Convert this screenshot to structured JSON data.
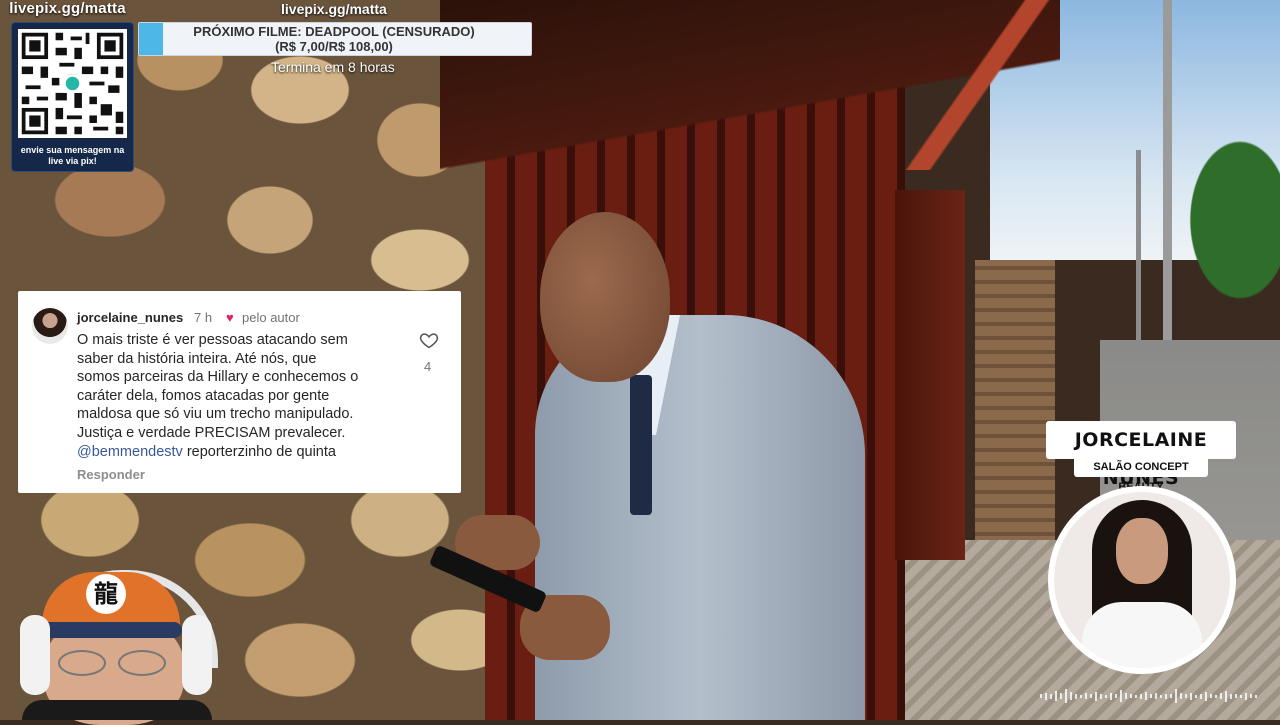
{
  "livepix": {
    "qr_title": "livepix.gg/matta",
    "qr_caption": "envie sua mensagem na live via pix!",
    "top_url": "livepix.gg/matta"
  },
  "film_banner": {
    "line1": "PRÓXIMO FILME: DEADPOOL (CENSURADO)",
    "line2": "(R$ 7,00/R$ 108,00)",
    "subtitle": "Termina em 8 horas",
    "accent_color": "#4db8e8"
  },
  "comment": {
    "username": "jorcelaine_nunes",
    "time": "7 h",
    "heart_icon": "heart-icon",
    "by_author": "pelo autor",
    "body_lines": [
      "O mais triste é ver pessoas atacando sem",
      "saber da história inteira. Até nós, que",
      "somos parceiras da Hillary e conhecemos o",
      "caráter dela, fomos atacadas por gente",
      "maldosa que só viu um trecho manipulado.",
      "Justiça e verdade PRECISAM prevalecer."
    ],
    "mention": "@bemmendestv",
    "mention_rest": " reporterzinho de quinta",
    "like_count": "4",
    "reply_label": "Responder",
    "heart_color": "#e0245e",
    "mention_color": "#385898"
  },
  "name_plate": {
    "name": "JORCELAINE NUNES",
    "subtitle": "SALÃO CONCEPT BEAUTY"
  },
  "webcam": {
    "cap_logo": "龍"
  }
}
